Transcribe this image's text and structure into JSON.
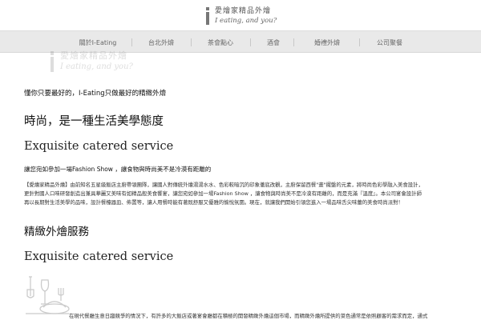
{
  "header": {
    "logo_cn": "愛燴家精品外燴",
    "logo_en": "I eating, and you?"
  },
  "nav": {
    "items": [
      {
        "label": "關於I-Eating"
      },
      {
        "label": "台北外燴"
      },
      {
        "label": "茶會點心"
      },
      {
        "label": "酒會"
      },
      {
        "label": "婚禮外燴"
      },
      {
        "label": "公司聚餐"
      }
    ]
  },
  "watermark": {
    "cn": "愛燴家精品外燴",
    "en": "I eating, and you?"
  },
  "main": {
    "intro": "懂你只要最好的，I-Eating只做最好的精緻外燴",
    "heading1": "時尚，是一種生活美學態度",
    "heading1_en": "Exquisite catered service",
    "subheading": "讓您宛如參加一場Fashion Show ，讓食物與時尚美不是冷漠有距離的",
    "paragraph_lines": [
      "【愛燴家精品外燴】由前知名五星級飯店主廚帶領團隊，讓國人對傳統外燴湯湯水水、色彩較暗沉的印象徹底改觀，主廚保留西餐\"畫\"擺盤的元素，將時尚色彩學融入美食設計，",
      "更針對國人口味研發創造出兼具華麗又美味有如精品般美食饗宴，讓您宛如參加一場Fashion Show ，讓食物與時尚美不是冷漠有距離的，而是充滿『溫度』。本公司宴會設計師",
      "再以長期對生活美學的品味，設計餐檯器皿、佈置等，讓人用餐時能有著既舒服又優雅的愉悅氛圍。現在，就讓我們開始引領您進入一場品味舌尖味蕾的美食時尚派對！"
    ],
    "heading2": "精緻外燴服務",
    "heading2_en": "Exquisite catered service",
    "bottom_text": "在現代餐廳生意日趨競爭的情況下，有許多的大飯店或著宴會廳都在積極的開發精緻外燴這個市場，而精緻外燴所提供的菜色通常是依照顧客的需求而定，通式"
  },
  "colors": {
    "nav_bg": "#e9e9e9",
    "text": "#111111",
    "muted": "#666666"
  }
}
